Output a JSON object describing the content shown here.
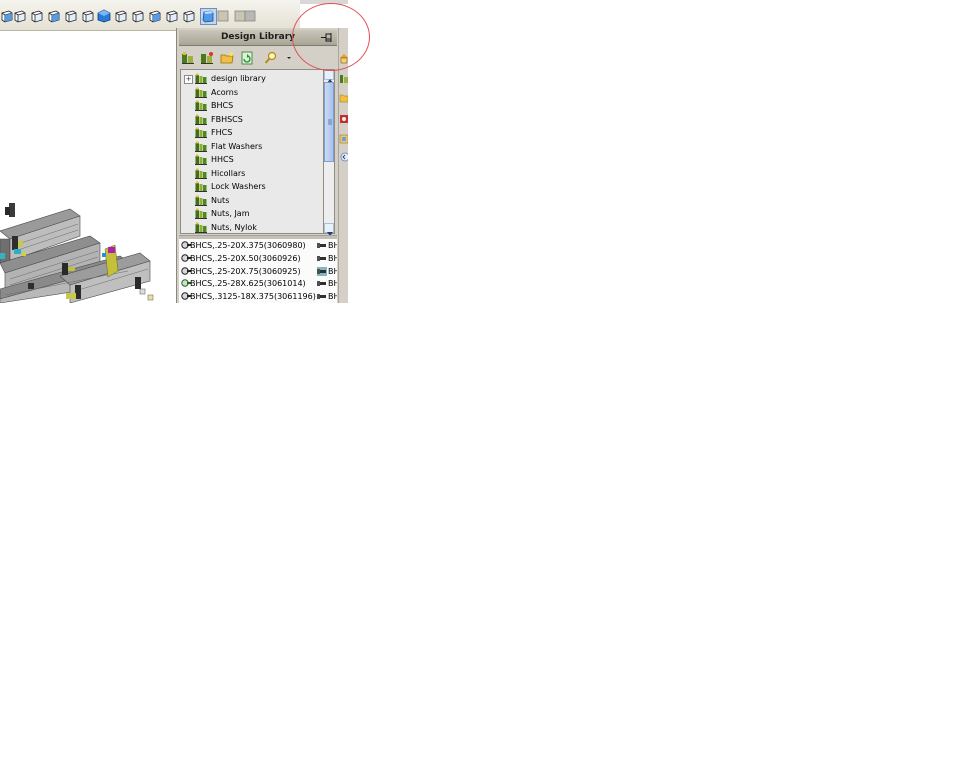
{
  "panel": {
    "title": "Design Library",
    "toolbar_icons": [
      "add-to-library-icon",
      "add-file-location-icon",
      "create-folder-icon",
      "refresh-icon",
      "search-icon",
      "dropdown-arrow-icon"
    ]
  },
  "tree": {
    "items": [
      {
        "label": "design library",
        "expander": "+",
        "icon": "folder-icon"
      },
      {
        "label": "Acorns",
        "icon": "folder-icon"
      },
      {
        "label": "BHCS",
        "icon": "folder-icon"
      },
      {
        "label": "FBHSCS",
        "icon": "folder-icon"
      },
      {
        "label": "FHCS",
        "icon": "folder-icon"
      },
      {
        "label": "Flat Washers",
        "icon": "folder-icon"
      },
      {
        "label": "HHCS",
        "icon": "folder-icon"
      },
      {
        "label": "Hicollars",
        "icon": "folder-icon"
      },
      {
        "label": "Lock Washers",
        "icon": "folder-icon"
      },
      {
        "label": "Nuts",
        "icon": "folder-icon"
      },
      {
        "label": "Nuts, Jam",
        "icon": "folder-icon"
      },
      {
        "label": "Nuts, Nylok",
        "icon": "folder-icon"
      }
    ]
  },
  "parts": {
    "items": [
      {
        "label": "BHCS,.25-20X.375(3060980)",
        "side": "BH"
      },
      {
        "label": "BHCS,.25-20X.50(3060926)",
        "side": "BH"
      },
      {
        "label": "BHCS,.25-20X.75(3060925)",
        "side": "BH"
      },
      {
        "label": "BHCS,.25-28X.625(3061014)",
        "side": "BH"
      },
      {
        "label": "BHCS,.3125-18X.375(3061196)",
        "side": "BH"
      }
    ]
  },
  "toolbar": {
    "icons": [
      "view-orientation-icon",
      "front-view-icon",
      "back-view-icon",
      "left-view-icon",
      "right-view-icon",
      "top-view-icon",
      "bottom-view-icon",
      "isometric-view-icon",
      "wireframe-icon",
      "hidden-lines-visible-icon",
      "hidden-lines-removed-icon",
      "shaded-with-edges-icon",
      "shaded-icon",
      "shadows-icon",
      "section-view-icon",
      "realview-icon"
    ]
  },
  "colors": {
    "panel_bg": "#d4d0c8",
    "title_bar": "#b8b5a8",
    "tree_bg": "#e9e9e9",
    "highlight": "#e05050",
    "accent_blue": "#2f6fc9"
  }
}
